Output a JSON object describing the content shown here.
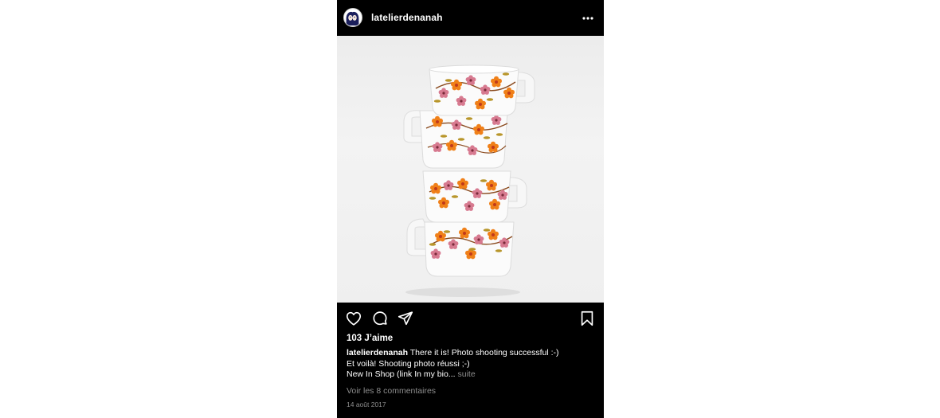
{
  "post": {
    "username": "latelierdenanah",
    "likes": "103 J’aime",
    "caption": {
      "username": "latelierdenanah",
      "line1": "There it is! Photo shooting successful :-)",
      "line2": "Et voilà! Shooting photo réussi ;-)",
      "line3": "New In Shop (link In my bio...",
      "more": "suite"
    },
    "comments_link": "Voir les 8 commentaires",
    "date": "14 août 2017"
  },
  "icons": {
    "more": "more-horizontal-icon",
    "like": "heart-icon",
    "comment": "comment-bubble-icon",
    "share": "send-icon",
    "save": "bookmark-icon"
  },
  "colors": {
    "background": "#000000",
    "text": "#ffffff",
    "muted": "#8e8e8e",
    "flower_orange": "#f07a1a",
    "flower_pink": "#d86a86",
    "stem": "#8a4a1e",
    "leaf": "#b7962a"
  }
}
